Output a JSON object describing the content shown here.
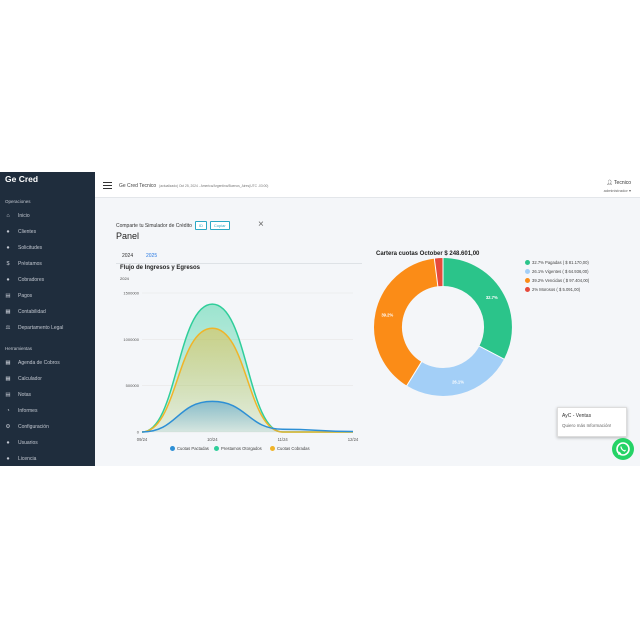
{
  "sidebar": {
    "brand": "Ge Cred",
    "section_ops": "Operaciones",
    "ops_items": [
      {
        "label": "Inicio",
        "icon": "home-icon"
      },
      {
        "label": "Clientes",
        "icon": "user-icon"
      },
      {
        "label": "Solicitudes",
        "icon": "users-icon"
      },
      {
        "label": "Préstamos",
        "icon": "dollar-icon"
      },
      {
        "label": "Cobradores",
        "icon": "group-icon"
      },
      {
        "label": "Pagos",
        "icon": "money-icon"
      },
      {
        "label": "Contabilidad",
        "icon": "calculator-icon"
      },
      {
        "label": "Departamento Legal",
        "icon": "gavel-icon"
      }
    ],
    "section_tools": "Herramientas",
    "tool_items": [
      {
        "label": "Agenda de Cobros",
        "icon": "calendar-icon"
      },
      {
        "label": "Calculador",
        "icon": "calculator-icon"
      },
      {
        "label": "Notas",
        "icon": "note-icon"
      },
      {
        "label": "Informes",
        "icon": "chart-icon"
      },
      {
        "label": "Configuración",
        "icon": "gear-icon"
      },
      {
        "label": "Usuarios",
        "icon": "user-icon"
      },
      {
        "label": "Licencia",
        "icon": "license-icon"
      }
    ]
  },
  "header": {
    "app": "Ge Cred Tecnico",
    "meta": "(actualizado) Oct 25, 2024 - America/Argentina/Buenos_Aires(UTC -03:00)",
    "user_name": "Tecnico",
    "user_role": "administrador"
  },
  "main": {
    "share_label": "Comparte tu Simulador de Crédito",
    "share_id_btn": "ID",
    "share_copy_btn": "Copiar",
    "title": "Panel",
    "tabs": [
      "2024",
      "2025"
    ],
    "flow_title": "Flujo de Ingresos y Egresos",
    "flow_year": "2024",
    "donut_title": "Cartera cuotas October $ 248.601,00"
  },
  "chart_data": [
    {
      "type": "area",
      "title": "Flujo de Ingresos y Egresos",
      "subtitle": "2024",
      "categories": [
        "09/24",
        "10/24",
        "11/24",
        "12/24"
      ],
      "y_ticks": [
        "0",
        "500000",
        "1000000",
        "1500000"
      ],
      "ylim": [
        0,
        1500000
      ],
      "legend_position": "bottom",
      "series": [
        {
          "name": "Cuotas Pactadas",
          "color": "#2d8fd5",
          "values": [
            0,
            330000,
            30000,
            5000
          ]
        },
        {
          "name": "Prestamos Otorgados",
          "color": "#2fce9a",
          "values": [
            0,
            1380000,
            0,
            0
          ]
        },
        {
          "name": "Cuotas Cobradas",
          "color": "#f0b429",
          "values": [
            0,
            1120000,
            0,
            0
          ]
        }
      ]
    },
    {
      "type": "pie",
      "title": "Cartera cuotas October $ 248.601,00",
      "legend_position": "right",
      "slices": [
        {
          "label": "32.7% Pagadas ( $ 81.170,00)",
          "pct": 32.7,
          "display": "32.7%",
          "color": "#2bc48a"
        },
        {
          "label": "26.1% Vigentes ( $ 64.936,00)",
          "pct": 26.1,
          "display": "26.1%",
          "color": "#a3cff7"
        },
        {
          "label": "39.2% Vencidas ( $ 97.404,00)",
          "pct": 39.2,
          "display": "39.2%",
          "color": "#fb8c17"
        },
        {
          "label": "2% Morosos ( $ 5.091,00)",
          "pct": 2.0,
          "display": "",
          "color": "#e64a3b"
        }
      ]
    }
  ],
  "popup": {
    "title": "AyC - Ventas",
    "subtitle": "Quiero más Información!"
  }
}
